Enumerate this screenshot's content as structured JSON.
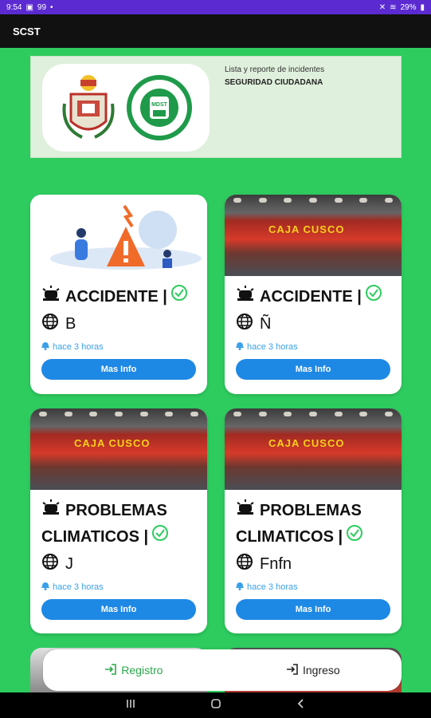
{
  "status_bar": {
    "time": "9:54",
    "signal_text": "99",
    "battery": "29%"
  },
  "app": {
    "title": "SCST"
  },
  "banner": {
    "line1": "Lista y reporte de incidentes",
    "line2": "SEGURIDAD CIUDADANA",
    "logo_right_text": "MDST"
  },
  "cards": [
    {
      "type": "ACCIDENTE |",
      "location": "B",
      "time": "hace 3 horas",
      "button": "Mas Info",
      "image": "illustration"
    },
    {
      "type": "ACCIDENTE |",
      "location": "Ñ",
      "time": "hace 3 horas",
      "button": "Mas Info",
      "image": "storefront-photo",
      "sign": "CAJA CUSCO"
    },
    {
      "type_line1": "PROBLEMAS",
      "type_line2": "CLIMATICOS |",
      "location": "J",
      "time": "hace 3 horas",
      "button": "Mas Info",
      "image": "storefront-photo",
      "sign": "CAJA CUSCO"
    },
    {
      "type_line1": "PROBLEMAS",
      "type_line2": "CLIMATICOS |",
      "location": "Fnfn",
      "time": "hace 3 horas",
      "button": "Mas Info",
      "image": "storefront-photo",
      "sign": "CAJA CUSCO"
    }
  ],
  "bottom_bar": {
    "register": "Registro",
    "login": "Ingreso"
  },
  "colors": {
    "background": "#2ecc5f",
    "accent_button": "#1e88e5",
    "status_bar": "#5b2bd1",
    "app_bar": "#111111",
    "check": "#2ecc5f"
  },
  "icons": [
    "alarm-siren-icon",
    "check-circle-icon",
    "globe-icon",
    "bell-icon",
    "login-arrow-icon",
    "recent-apps-icon",
    "home-icon",
    "back-icon"
  ]
}
